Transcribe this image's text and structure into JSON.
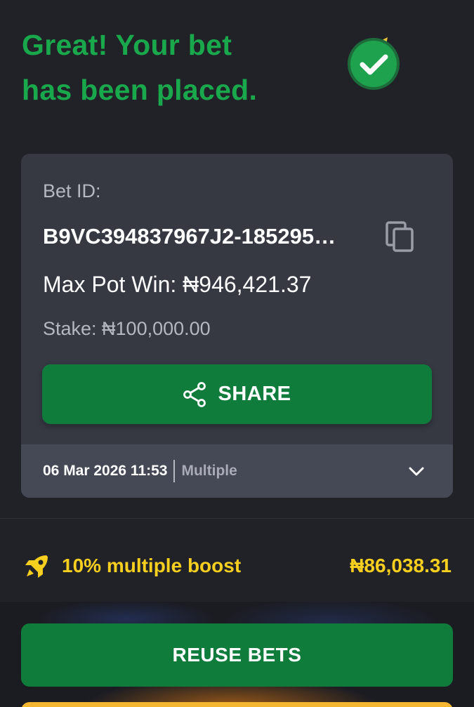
{
  "confirmation": {
    "line1": "Great! Your bet",
    "line2": "has been placed."
  },
  "bet": {
    "id_label": "Bet ID:",
    "id_value": "B9VC394837967J2-185295…",
    "max_pot_win": "Max Pot Win: ₦946,421.37",
    "stake": "Stake: ₦100,000.00",
    "share_label": "SHARE",
    "date": "06 Mar 2026 11:53",
    "bet_type": "Multiple"
  },
  "boost": {
    "label": "10% multiple boost",
    "amount": "₦86,038.31"
  },
  "actions": {
    "reuse_label": "REUSE BETS"
  },
  "colors": {
    "background": "#202227",
    "success_green": "#1aa84c",
    "button_green": "#0f7c3c",
    "card": "#363842",
    "card_footer": "#454855",
    "boost_yellow": "#f7cf1e"
  },
  "icons": {
    "success": "check-circle-icon",
    "copy": "copy-icon",
    "share": "share-icon",
    "expand": "chevron-down-icon",
    "boost": "rocket-icon"
  }
}
